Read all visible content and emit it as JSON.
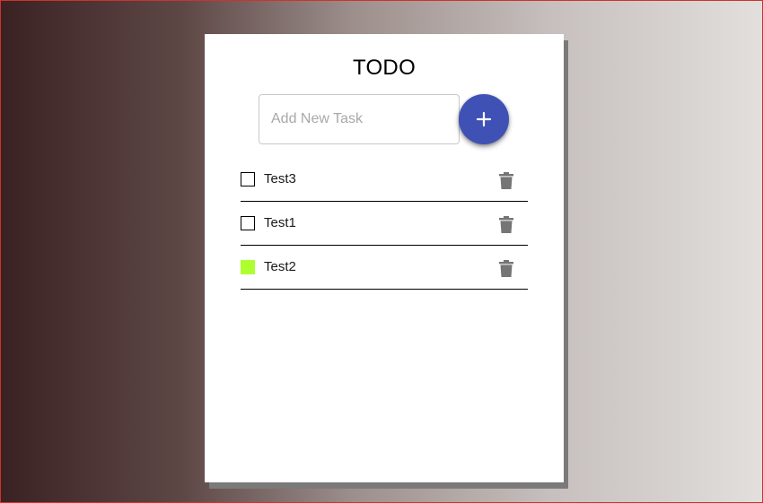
{
  "todo": {
    "title": "TODO",
    "add_input": {
      "value": "",
      "placeholder": "Add New Task"
    },
    "add_button": {
      "icon": "plus-icon",
      "color": "#3f51b5"
    },
    "tasks": [
      {
        "label": "Test3",
        "checked": false
      },
      {
        "label": "Test1",
        "checked": false
      },
      {
        "label": "Test2",
        "checked": true
      }
    ],
    "checked_color": "#adff2f",
    "delete_icon": "trash-icon",
    "delete_icon_color": "#757575"
  }
}
